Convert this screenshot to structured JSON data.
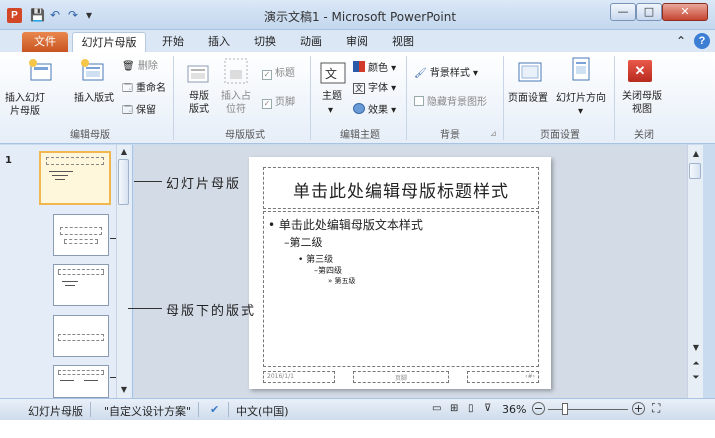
{
  "window": {
    "title": "演示文稿1 - Microsoft PowerPoint",
    "app_icon": "P",
    "controls": {
      "minimize": "—",
      "maximize": "□",
      "close": "✕"
    }
  },
  "quick_access": {
    "save": "💾",
    "undo": "↶",
    "redo": "↷",
    "customize": "▾"
  },
  "tabs": {
    "file": "文件",
    "items": [
      "幻灯片母版",
      "开始",
      "插入",
      "切换",
      "动画",
      "审阅",
      "视图"
    ],
    "collapse": "⌃",
    "help": "?"
  },
  "ribbon": {
    "edit_master": {
      "insert_slide_master": "插入幻灯片母版",
      "insert_layout": "插入版式",
      "delete": "删除",
      "rename": "重命名",
      "preserve": "保留",
      "group": "编辑母版"
    },
    "master_layout": {
      "master_layout": "母版版式",
      "insert_placeholder": "插入占位符",
      "title": "标题",
      "footer": "页脚",
      "group": "母版版式"
    },
    "edit_theme": {
      "themes": "主题",
      "colors": "颜色",
      "fonts": "字体",
      "effects": "效果",
      "group": "编辑主题"
    },
    "background": {
      "background_styles": "背景样式",
      "hide_background": "隐藏背景图形",
      "group": "背景"
    },
    "page_setup": {
      "page_setup": "页面设置",
      "orientation": "幻灯片方向",
      "group": "页面设置"
    },
    "close": {
      "close_master_view": "关闭母版视图",
      "group": "关闭"
    }
  },
  "thumbnails": {
    "master_number": "1"
  },
  "annotations": {
    "master": "幻灯片母版",
    "layouts": "母版下的版式"
  },
  "slide": {
    "title": "单击此处编辑母版标题样式",
    "level1": "• 单击此处编辑母版文本样式",
    "level2": "–第二级",
    "level3": "• 第三级",
    "level4": "–第四级",
    "level5": "» 第五级",
    "date": "2016/1/1",
    "footer": "页脚",
    "number": "‹#›"
  },
  "status": {
    "view": "幻灯片母版",
    "theme": "\"自定义设计方案\"",
    "language": "中文(中国)",
    "zoom": "36%",
    "zoom_out": "−",
    "zoom_in": "+",
    "fit": "⛶"
  }
}
